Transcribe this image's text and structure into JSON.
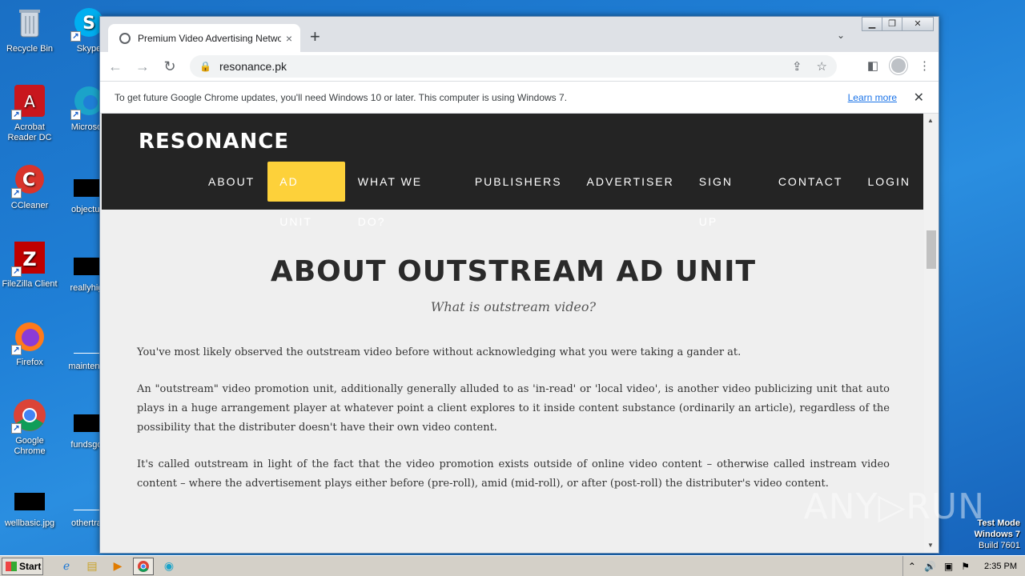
{
  "desktop": {
    "icons": [
      {
        "label": "Recycle Bin"
      },
      {
        "label": "Skype"
      },
      {
        "label": "Acrobat Reader DC"
      },
      {
        "label": "Microsoft"
      },
      {
        "label": "CCleaner"
      },
      {
        "label": "objectunl"
      },
      {
        "label": "FileZilla Client"
      },
      {
        "label": "reallyhigh"
      },
      {
        "label": "Firefox"
      },
      {
        "label": "maintenan"
      },
      {
        "label": "Google Chrome"
      },
      {
        "label": "fundsgoo"
      },
      {
        "label": "wellbasic.jpg"
      },
      {
        "label": "othertrad"
      }
    ],
    "watermark": "ANY▷RUN",
    "test_mode": {
      "line1": "Test Mode",
      "line2": "Windows 7",
      "line3": "Build 7601"
    }
  },
  "browser": {
    "tab_title": "Premium Video Advertising Network",
    "tab_close": "×",
    "new_tab": "+",
    "tab_menu": "⌄",
    "url": "resonance.pk",
    "window_buttons": {
      "minimize": "▁",
      "restore": "❐",
      "close": "✕"
    },
    "infobar": {
      "message": "To get future Google Chrome updates, you'll need Windows 10 or later. This computer is using Windows 7.",
      "link": "Learn more",
      "close": "✕"
    }
  },
  "site": {
    "logo": "RESONANCE",
    "menu": [
      "ABOUT",
      "AD UNIT",
      "WHAT WE DO?",
      "PUBLISHERS",
      "ADVERTISER",
      "SIGN UP",
      "CONTACT",
      "LOGIN"
    ],
    "active_menu": "AD UNIT",
    "accent": "#fdd13a",
    "title": "ABOUT OUTSTREAM AD UNIT",
    "subtitle": "What is outstream video?",
    "paragraphs": [
      "You've most likely observed the outstream video before without acknowledging what you were taking a gander at.",
      "An \"outstream\" video promotion unit, additionally generally alluded to as 'in-read' or 'local video', is another video publicizing unit that auto plays in a huge arrangement player at whatever point a client explores to it inside content substance (ordinarily an article), regardless of the possibility that the distributer doesn't have their own video content.",
      "It's called outstream in light of the fact that the video promotion exists outside of online video content – otherwise called instream video content – where the advertisement plays either before (pre-roll), amid (mid-roll), or after (post-roll) the distributer's video content."
    ]
  },
  "taskbar": {
    "start": "Start",
    "clock": "2:35 PM"
  }
}
